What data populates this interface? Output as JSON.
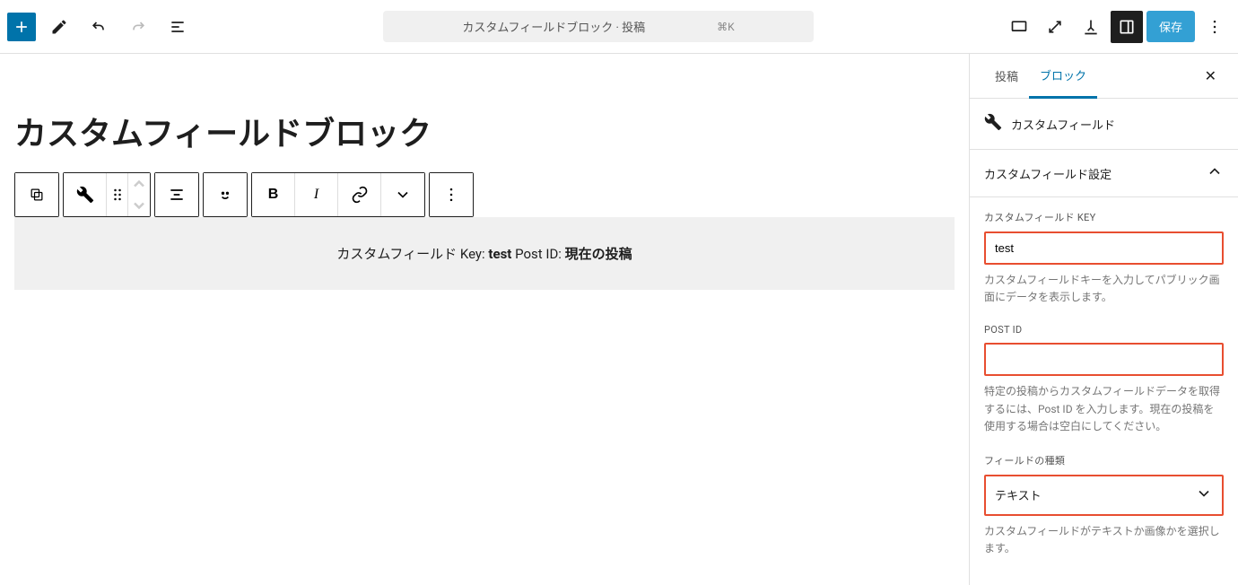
{
  "topbar": {
    "doc_title": "カスタムフィールドブロック · 投稿",
    "kbd": "⌘K",
    "save_label": "保存"
  },
  "editor": {
    "title": "カスタムフィールドブロック",
    "block_text_prefix": "カスタムフィールド Key: ",
    "block_key": "test",
    "block_text_mid": " Post ID: ",
    "block_post": "現在の投稿"
  },
  "sidebar": {
    "tabs": {
      "post": "投稿",
      "block": "ブロック"
    },
    "block_name": "カスタムフィールド",
    "section_title": "カスタムフィールド設定",
    "key_label": "カスタムフィールド KEY",
    "key_value": "test",
    "key_help": "カスタムフィールドキーを入力してパブリック画面にデータを表示します。",
    "postid_label": "POST ID",
    "postid_value": "",
    "postid_help": "特定の投稿からカスタムフィールドデータを取得するには、Post ID を入力します。現在の投稿を使用する場合は空白にしてください。",
    "type_label": "フィールドの種類",
    "type_value": "テキスト",
    "type_help": "カスタムフィールドがテキストか画像かを選択します。"
  }
}
